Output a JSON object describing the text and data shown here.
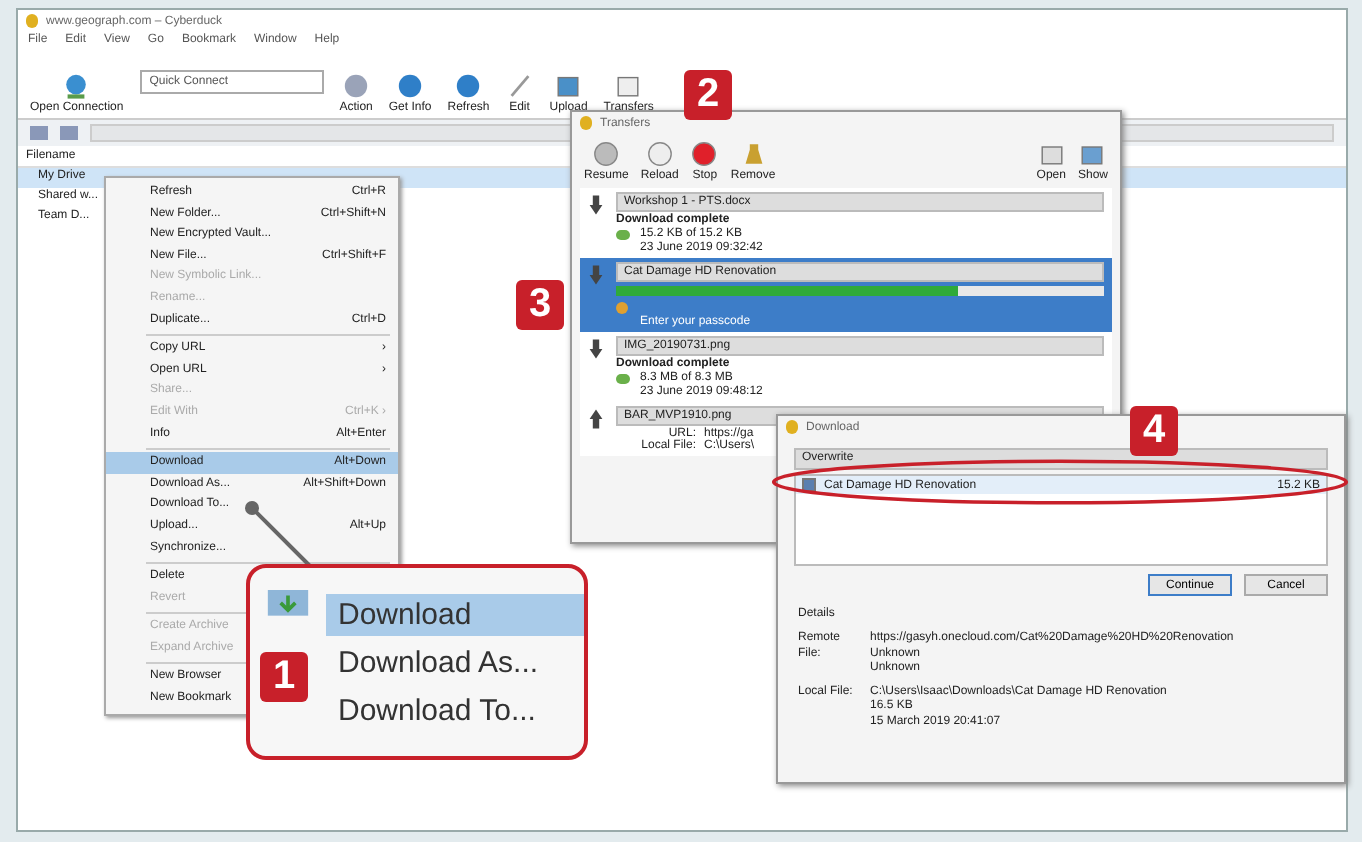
{
  "window": {
    "title": "www.geograph.com – Cyberduck"
  },
  "menu_bar": [
    "File",
    "Edit",
    "View",
    "Go",
    "Bookmark",
    "Window",
    "Help"
  ],
  "toolbar": {
    "open_connection": "Open Connection",
    "quick_connect": "Quick Connect",
    "buttons": [
      "Action",
      "Get Info",
      "Refresh",
      "Edit",
      "Upload",
      "Transfers"
    ]
  },
  "browser": {
    "column": "Filename",
    "items": [
      {
        "label": "My Drive",
        "selected": true
      },
      {
        "label": "Shared w...",
        "selected": false
      },
      {
        "label": "Team D...",
        "selected": false
      }
    ]
  },
  "context_menu": [
    {
      "kind": "item",
      "label": "Refresh",
      "shortcut": "Ctrl+R",
      "disabled": false,
      "selected": false
    },
    {
      "kind": "item",
      "label": "New Folder...",
      "shortcut": "Ctrl+Shift+N",
      "disabled": false,
      "selected": false
    },
    {
      "kind": "item",
      "label": "New Encrypted Vault...",
      "disabled": false,
      "selected": false
    },
    {
      "kind": "item",
      "label": "New File...",
      "shortcut": "Ctrl+Shift+F",
      "disabled": false,
      "selected": false
    },
    {
      "kind": "item",
      "label": "New Symbolic Link...",
      "disabled": true,
      "selected": false
    },
    {
      "kind": "item",
      "label": "Rename...",
      "disabled": true,
      "selected": false
    },
    {
      "kind": "item",
      "label": "Duplicate...",
      "shortcut": "Ctrl+D",
      "disabled": false,
      "selected": false
    },
    {
      "kind": "separator"
    },
    {
      "kind": "item",
      "label": "Copy URL",
      "shortcut": "›",
      "disabled": false,
      "selected": false
    },
    {
      "kind": "item",
      "label": "Open URL",
      "shortcut": "›",
      "disabled": false,
      "selected": false
    },
    {
      "kind": "item",
      "label": "Share...",
      "disabled": true,
      "selected": false
    },
    {
      "kind": "item",
      "label": "Edit With",
      "shortcut": "Ctrl+K ›",
      "disabled": true,
      "selected": false
    },
    {
      "kind": "item",
      "label": "Info",
      "shortcut": "Alt+Enter",
      "disabled": false,
      "selected": false
    },
    {
      "kind": "separator"
    },
    {
      "kind": "item",
      "label": "Download",
      "shortcut": "Alt+Down",
      "disabled": false,
      "selected": true
    },
    {
      "kind": "item",
      "label": "Download As...",
      "shortcut": "Alt+Shift+Down",
      "disabled": false,
      "selected": false
    },
    {
      "kind": "item",
      "label": "Download To...",
      "disabled": false,
      "selected": false
    },
    {
      "kind": "item",
      "label": "Upload...",
      "shortcut": "Alt+Up",
      "disabled": false,
      "selected": false
    },
    {
      "kind": "item",
      "label": "Synchronize...",
      "disabled": false,
      "selected": false
    },
    {
      "kind": "separator"
    },
    {
      "kind": "item",
      "label": "Delete",
      "disabled": false,
      "selected": false
    },
    {
      "kind": "item",
      "label": "Revert",
      "disabled": true,
      "selected": false
    },
    {
      "kind": "separator"
    },
    {
      "kind": "item",
      "label": "Create Archive",
      "disabled": true,
      "selected": false
    },
    {
      "kind": "item",
      "label": "Expand Archive",
      "disabled": true,
      "selected": false
    },
    {
      "kind": "separator"
    },
    {
      "kind": "item",
      "label": "New Browser",
      "disabled": false,
      "selected": false
    },
    {
      "kind": "item",
      "label": "New Bookmark",
      "disabled": false,
      "selected": false
    }
  ],
  "callout": {
    "badge": "1",
    "items": [
      {
        "label": "Download",
        "selected": true
      },
      {
        "label": "Download As...",
        "selected": false
      },
      {
        "label": "Download To...",
        "selected": false
      }
    ]
  },
  "transfers_window": {
    "title": "Transfers",
    "badge_stop": "2",
    "badge_selected": "3",
    "toolbar": [
      "Resume",
      "Reload",
      "Stop",
      "Remove",
      "Open",
      "Show"
    ],
    "items": [
      {
        "kind": "download",
        "name": "Workshop 1 - PTS.docx",
        "status": "Download complete",
        "size": "15.2 KB of 15.2 KB",
        "date": "23 June 2019 09:32:42",
        "selected": false
      },
      {
        "kind": "active",
        "name": "Cat Damage HD Renovation",
        "level": 0.7,
        "status": "Enter your passcode",
        "selected": true
      },
      {
        "kind": "download",
        "name": "IMG_20190731.png",
        "status": "Download complete",
        "size": "8.3 MB of 8.3 MB",
        "date": "23 June 2019 09:48:12",
        "selected": false
      },
      {
        "kind": "upload",
        "name": "BAR_MVP1910.png",
        "url_label": "URL:",
        "url": "https://ga",
        "local_label": "Local File:",
        "local": "C:\\Users\\",
        "selected": false
      }
    ]
  },
  "download_dialog": {
    "title": "Download",
    "badge": "4",
    "action": "Overwrite",
    "file": "Cat Damage HD Renovation",
    "file_checked": true,
    "file_size": "15.2 KB",
    "buttons": [
      "Continue",
      "Cancel"
    ],
    "details": "Details",
    "remote_label": "Remote File:",
    "remote": [
      "https://gasyh.onecloud.com/Cat%20Damage%20HD%20Renovation",
      "Unknown",
      "Unknown"
    ],
    "local_label": "Local File:",
    "local": [
      "C:\\Users\\Isaac\\Downloads\\Cat Damage HD Renovation",
      "16.5 KB",
      "15 March 2019 20:41:07"
    ]
  }
}
